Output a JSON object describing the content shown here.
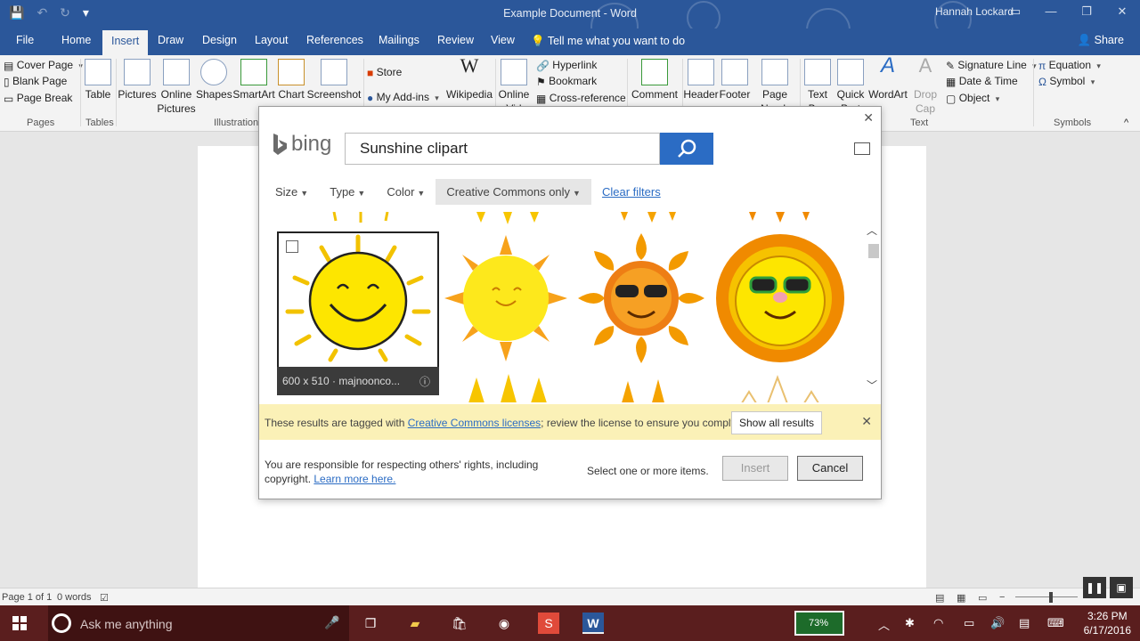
{
  "window": {
    "title": "Example Document - Word",
    "user": "Hannah Lockard"
  },
  "tabs": [
    {
      "label": "File"
    },
    {
      "label": "Home"
    },
    {
      "label": "Insert"
    },
    {
      "label": "Draw"
    },
    {
      "label": "Design"
    },
    {
      "label": "Layout"
    },
    {
      "label": "References"
    },
    {
      "label": "Mailings"
    },
    {
      "label": "Review"
    },
    {
      "label": "View"
    }
  ],
  "tell_me": "Tell me what you want to do",
  "share": "Share",
  "ribbon": {
    "pages": {
      "cover": "Cover Page",
      "blank": "Blank Page",
      "break": "Page Break",
      "label": "Pages"
    },
    "tables": {
      "table": "Table",
      "label": "Tables"
    },
    "illustrations": {
      "pictures": "Pictures",
      "online_pictures_1": "Online",
      "online_pictures_2": "Pictures",
      "shapes": "Shapes",
      "smartart": "SmartArt",
      "chart": "Chart",
      "screenshot": "Screenshot",
      "label": "Illustration"
    },
    "addins": {
      "store": "Store",
      "my_addins": "My Add-ins",
      "wikipedia": "Wikipedia"
    },
    "media": {
      "online_video_1": "Online",
      "online_video_2": "Vid"
    },
    "links": {
      "hyperlink": "Hyperlink",
      "bookmark": "Bookmark",
      "cross_reference": "Cross-reference"
    },
    "comments": {
      "comment": "Comment"
    },
    "header_footer": {
      "header": "Header",
      "footer": "Footer",
      "page_number_1": "Page",
      "page_number_2": "Numb"
    },
    "text": {
      "text_box_1": "Text",
      "text_box_2": "Box",
      "quick_parts_1": "Quick",
      "quick_parts_2": "Part",
      "wordart": "WordArt",
      "drop_cap_1": "Drop",
      "drop_cap_2": "Cap",
      "label": "Text"
    },
    "text_extra": {
      "signature": "Signature Line",
      "date_time": "Date & Time",
      "object": "Object"
    },
    "symbols": {
      "equation": "Equation",
      "symbol": "Symbol",
      "label": "Symbols"
    }
  },
  "dialog": {
    "brand": "bing",
    "search_value": "Sunshine clipart",
    "filters": [
      "Size",
      "Type",
      "Color",
      "Creative Commons only"
    ],
    "clear_filters": "Clear filters",
    "selected_caption": "600 x 510 · majnoonco...",
    "notice_pre": "These results are tagged with ",
    "notice_link": "Creative Commons licenses",
    "notice_post": "; review the license to ensure you comply.",
    "show_all": "Show all results",
    "resp_line1": "You are responsible for respecting others' rights, including",
    "resp_line2_pre": "copyright. ",
    "resp_link": "Learn more here.",
    "select_info": "Select one or more items.",
    "insert": "Insert",
    "cancel": "Cancel"
  },
  "status": {
    "page": "Page 1 of 1",
    "words": "0 words"
  },
  "taskbar": {
    "ask": "Ask me anything",
    "battery": "73%",
    "time": "3:26 PM",
    "date": "6/17/2016"
  },
  "colors": {
    "word_blue": "#2b579a",
    "bing_blue": "#2b6cc4",
    "notice_yellow": "#fbf1b7",
    "taskbar": "#5a1e1e"
  }
}
